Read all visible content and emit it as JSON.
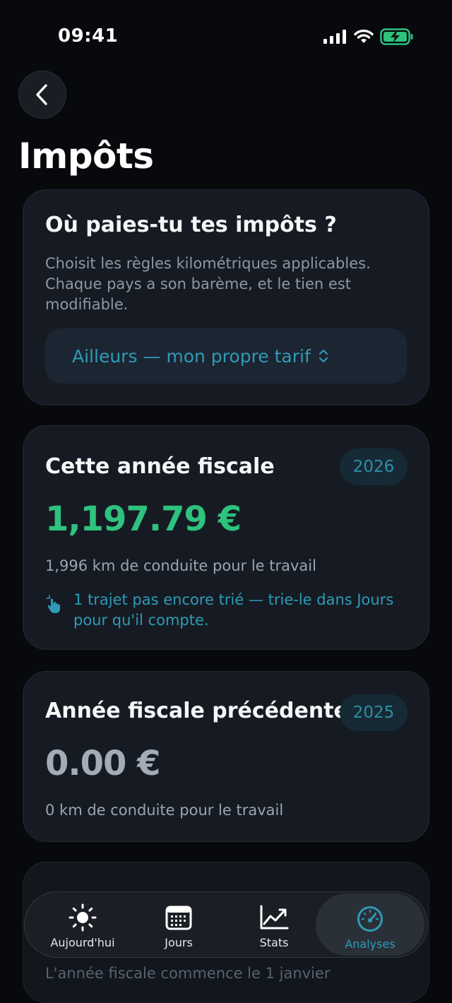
{
  "status_bar": {
    "time": "09:41"
  },
  "header": {
    "title": "Impôts"
  },
  "tax_country": {
    "title": "Où paies-tu tes impôts ?",
    "description": "Choisit les règles kilométriques applicables. Chaque pays a son barème, et le tien est modifiable.",
    "selected": "Ailleurs — mon propre tarif"
  },
  "current_year": {
    "title": "Cette année fiscale",
    "year": "2026",
    "amount": "1,197.79 €",
    "km_text": "1,996 km de conduite pour le travail",
    "hint": "1 trajet pas encore trié — trie-le dans Jours pour qu'il compte."
  },
  "previous_year": {
    "title": "Année fiscale précédente",
    "year": "2025",
    "amount": "0.00 €",
    "km_text": "0 km de conduite pour le travail"
  },
  "footer_note": "L'année fiscale commence le 1 janvier",
  "tabs": [
    {
      "label": "Aujourd'hui",
      "icon": "sun-icon"
    },
    {
      "label": "Jours",
      "icon": "calendar-icon"
    },
    {
      "label": "Stats",
      "icon": "chart-icon"
    },
    {
      "label": "Analyses",
      "icon": "gauge-icon",
      "active": true
    }
  ],
  "colors": {
    "accent": "#2e9bb6",
    "positive": "#2ec27e",
    "background": "#07090c",
    "card": "#161b23"
  }
}
